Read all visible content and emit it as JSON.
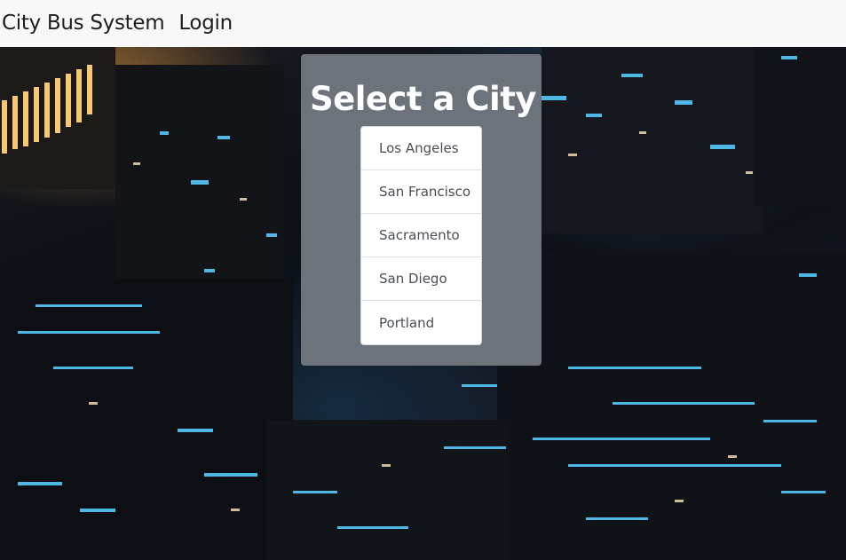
{
  "navbar": {
    "brand": "City Bus System",
    "login": "Login"
  },
  "background": {
    "description_icon": "city-night-aerial-image"
  },
  "city_select": {
    "title": "Select a City",
    "cities": [
      "Los Angeles",
      "San Francisco",
      "Sacramento",
      "San Diego",
      "Portland"
    ]
  },
  "colors": {
    "navbar_bg": "#f8f8f8",
    "card_bg": "#6c737b",
    "list_bg": "#ffffff",
    "title_text": "#ffffff"
  }
}
